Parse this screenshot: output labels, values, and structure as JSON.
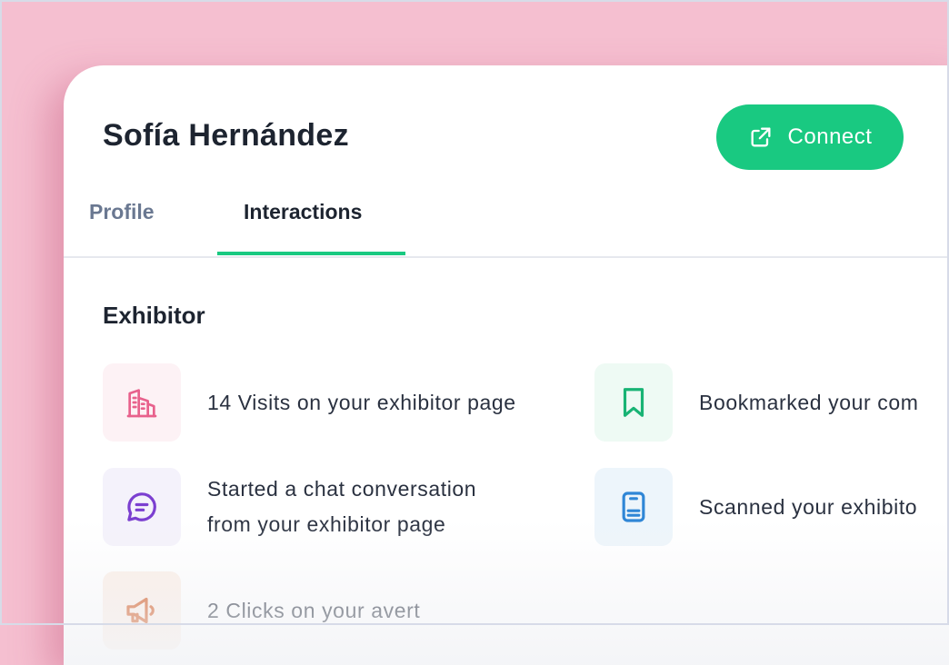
{
  "header": {
    "name": "Sofía Hernández",
    "connect_label": "Connect"
  },
  "tabs": [
    {
      "label": "Profile",
      "active": false
    },
    {
      "label": "Interactions",
      "active": true
    }
  ],
  "section": {
    "title": "Exhibitor"
  },
  "interactions": [
    {
      "icon": "building-icon",
      "text": "14 Visits on your exhibitor page",
      "icon_color": "#e8618c",
      "bg_color": "#fdf2f5"
    },
    {
      "icon": "bookmark-icon",
      "text": "Bookmarked your com",
      "icon_color": "#18b374",
      "bg_color": "#eefaf4"
    },
    {
      "icon": "chat-bubble-icon",
      "text_lines": [
        "Started a chat conversation",
        "from your exhibitor page"
      ],
      "icon_color": "#7b3fd0",
      "bg_color": "#f4f2fb"
    },
    {
      "icon": "badge-scan-icon",
      "text": "Scanned your exhibito",
      "icon_color": "#2f86d6",
      "bg_color": "#edf5fb"
    },
    {
      "icon": "megaphone-icon",
      "text": "2 Clicks on your avert",
      "icon_color": "#d0551c",
      "bg_color": "#fbeee6"
    }
  ],
  "colors": {
    "accent": "#19c981",
    "background": "#f5bfd0",
    "title_text": "#1d2430",
    "muted_tab": "#6a7891"
  }
}
